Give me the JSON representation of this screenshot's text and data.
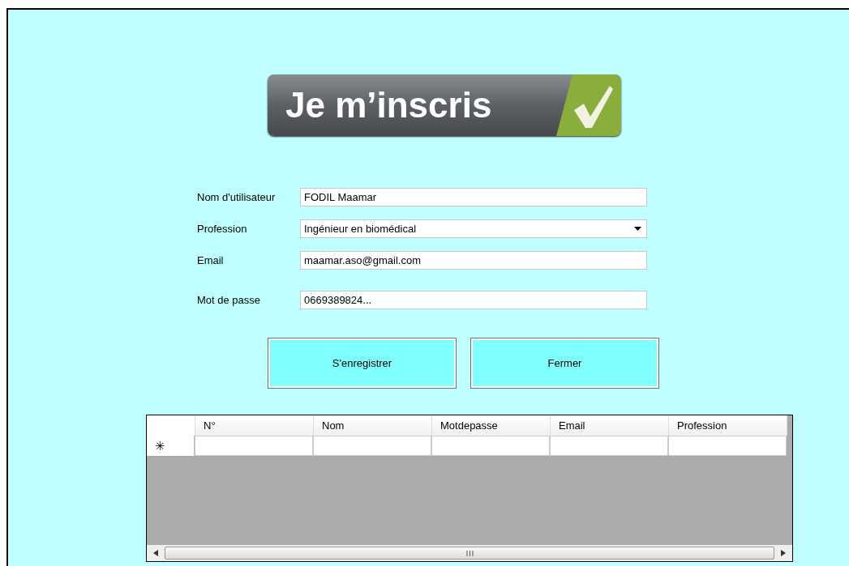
{
  "logo": {
    "text": "Je m’inscris"
  },
  "form": [
    {
      "kind": "text",
      "label": "Nom d'utilisateur",
      "value": "FODIL Maamar"
    },
    {
      "kind": "dropdown",
      "label": "Profession",
      "value": "Ingénieur en biomédical"
    },
    {
      "kind": "text",
      "label": "Email",
      "value": "maamar.aso@gmail.com"
    },
    {
      "kind": "text",
      "label": "Mot de passe",
      "value": "0669389824..."
    }
  ],
  "buttons": [
    "S'enregistrer",
    "Fermer"
  ],
  "table": {
    "columns": [
      "N°",
      "Nom",
      "Motdepasse",
      "Email",
      "Profession"
    ],
    "new_row_marker": "✳"
  }
}
